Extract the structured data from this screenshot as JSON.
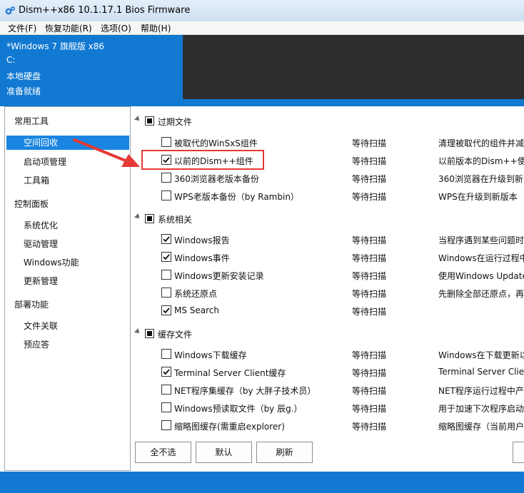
{
  "window": {
    "title": "Dism++x86 10.1.17.1 Bios Firmware"
  },
  "menu": [
    "文件(F)",
    "恢复功能(R)",
    "选项(O)",
    "帮助(H)"
  ],
  "system": {
    "os": "*Windows 7 旗舰版 x86",
    "drive": "C:",
    "disk_type": "本地硬盘",
    "status": "准备就绪"
  },
  "nav": {
    "sections": [
      {
        "title": "常用工具",
        "items": [
          "空间回收",
          "启动项管理",
          "工具箱"
        ]
      },
      {
        "title": "控制面板",
        "items": [
          "系统优化",
          "驱动管理",
          "Windows功能",
          "更新管理"
        ]
      },
      {
        "title": "部署功能",
        "items": [
          "文件关联",
          "预应答"
        ]
      }
    ],
    "selected": "空间回收"
  },
  "groups": [
    {
      "title": "过期文件",
      "items": [
        {
          "label": "被取代的WinSxS组件",
          "status": "等待扫描",
          "desc": "清理被取代的组件并减",
          "checked": false
        },
        {
          "label": "以前的Dism++组件",
          "status": "等待扫描",
          "desc": "以前版本的Dism++使",
          "checked": true
        },
        {
          "label": "360浏览器老版本备份",
          "status": "等待扫描",
          "desc": "360浏览器在升级到新",
          "checked": false
        },
        {
          "label": "WPS老版本备份（by Rambin）",
          "status": "等待扫描",
          "desc": "WPS在升级到新版本",
          "checked": false
        }
      ]
    },
    {
      "title": "系统相关",
      "items": [
        {
          "label": "Windows报告",
          "status": "等待扫描",
          "desc": "当程序遇到某些问题时",
          "checked": true
        },
        {
          "label": "Windows事件",
          "status": "等待扫描",
          "desc": "Windows在运行过程中",
          "checked": true
        },
        {
          "label": "Windows更新安装记录",
          "status": "等待扫描",
          "desc": "使用Windows Update",
          "checked": false
        },
        {
          "label": "系统还原点",
          "status": "等待扫描",
          "desc": "先删除全部还原点，再",
          "checked": false
        },
        {
          "label": "MS Search",
          "status": "等待扫描",
          "desc": "",
          "checked": true
        }
      ]
    },
    {
      "title": "缓存文件",
      "items": [
        {
          "label": "Windows下载缓存",
          "status": "等待扫描",
          "desc": "Windows在下载更新以",
          "checked": false
        },
        {
          "label": "Terminal Server Client缓存",
          "status": "等待扫描",
          "desc": "Terminal Server Clier",
          "checked": true
        },
        {
          "label": "NET程序集缓存（by 大胖子技术员）",
          "status": "等待扫描",
          "desc": "NET程序运行过程中产",
          "checked": false
        },
        {
          "label": "Windows预读取文件（by 辰g.）",
          "status": "等待扫描",
          "desc": "用于加速下次程序启动",
          "checked": false
        },
        {
          "label": "缩略图缓存(需重启explorer)",
          "status": "等待扫描",
          "desc": "缩略图缓存（当前用户",
          "checked": false
        }
      ]
    }
  ],
  "buttons": {
    "deselect_all": "全不选",
    "default": "默认",
    "refresh": "刷新"
  },
  "colors": {
    "accent": "#1179d2",
    "selected": "#1a85e0",
    "annotation": "#e53935",
    "dark": "#2d2d30"
  }
}
